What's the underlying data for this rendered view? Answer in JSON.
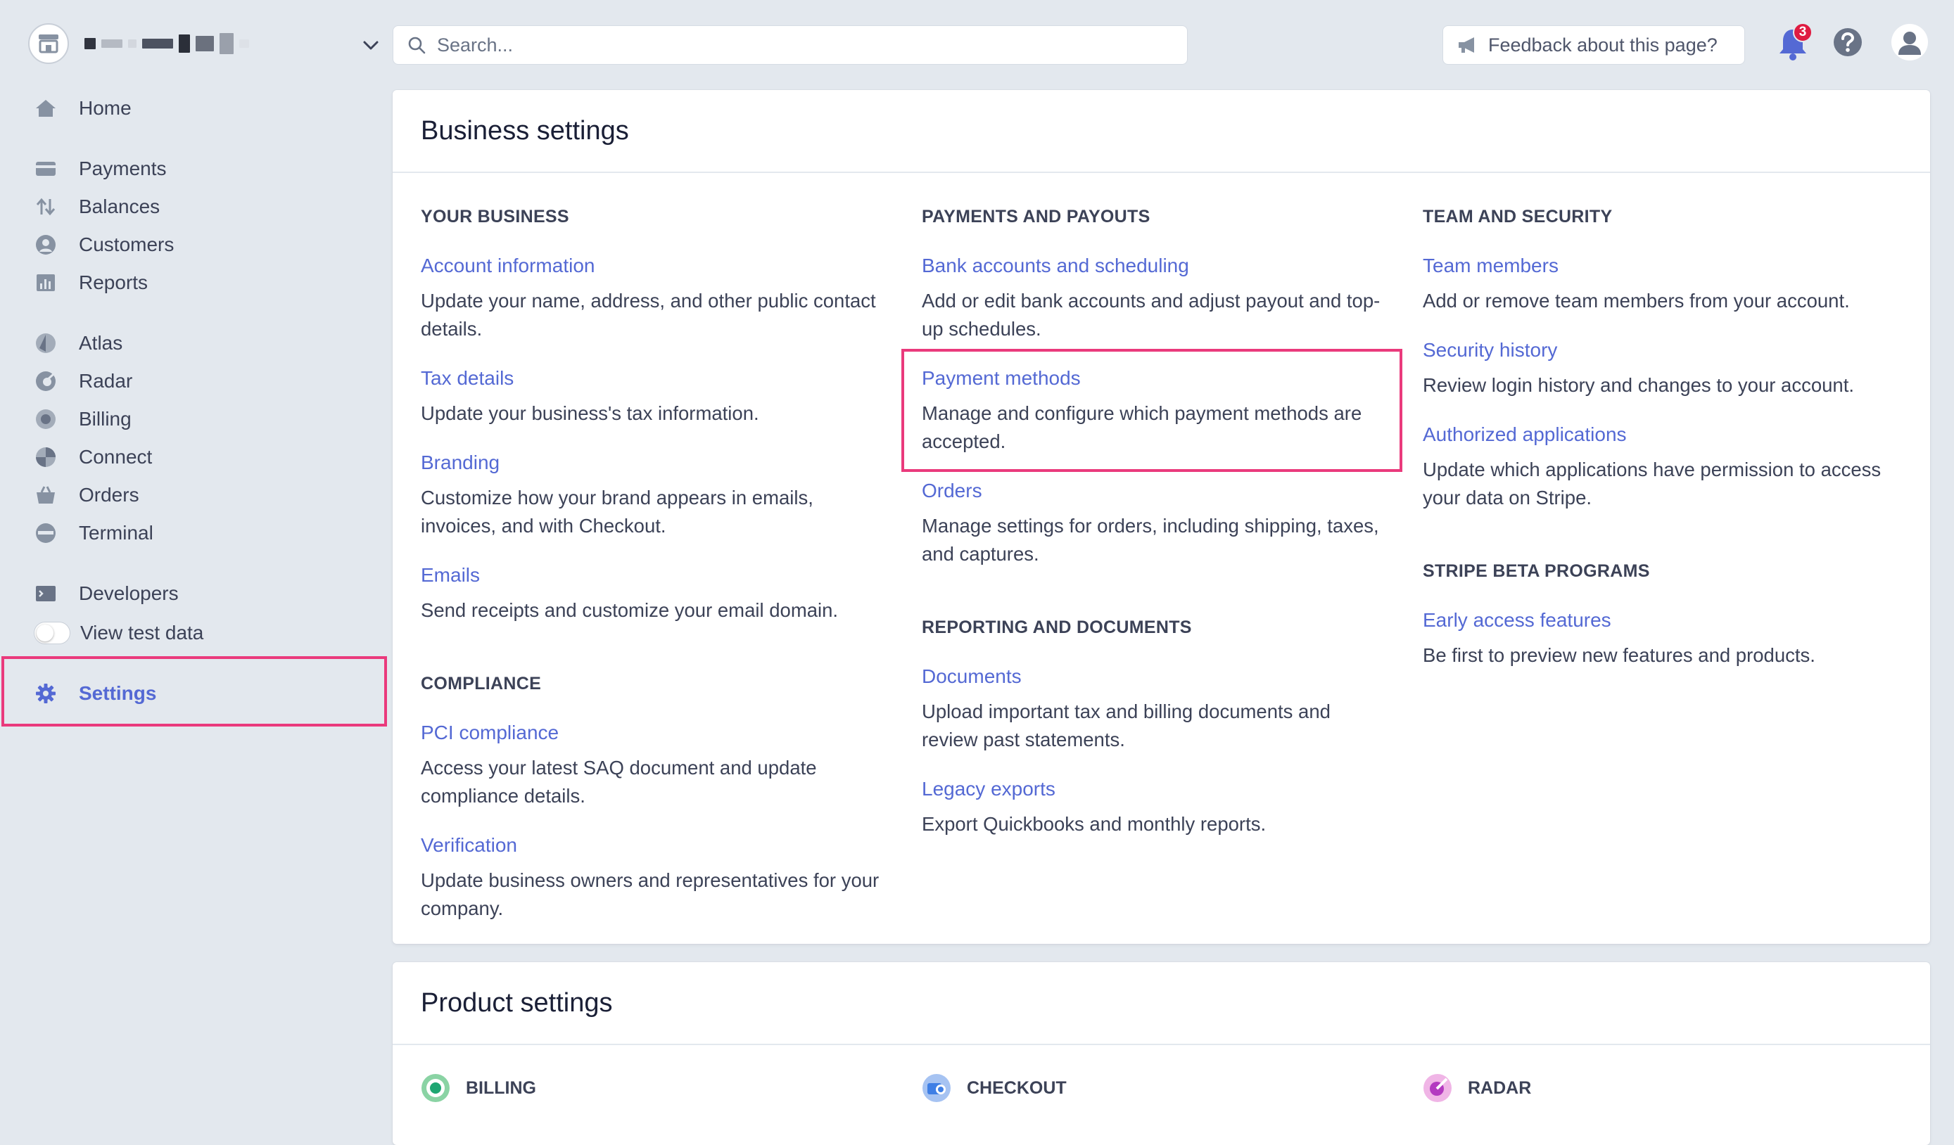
{
  "topbar": {
    "account_name": "",
    "search_placeholder": "Search...",
    "feedback_label": "Feedback about this page?",
    "notification_count": "3"
  },
  "sidebar": {
    "items": [
      {
        "label": "Home",
        "icon": "home-icon"
      },
      {
        "label": "Payments",
        "icon": "payments-icon"
      },
      {
        "label": "Balances",
        "icon": "balances-icon"
      },
      {
        "label": "Customers",
        "icon": "customers-icon"
      },
      {
        "label": "Reports",
        "icon": "reports-icon"
      },
      {
        "label": "Atlas",
        "icon": "atlas-icon"
      },
      {
        "label": "Radar",
        "icon": "radar-icon"
      },
      {
        "label": "Billing",
        "icon": "billing-icon"
      },
      {
        "label": "Connect",
        "icon": "connect-icon"
      },
      {
        "label": "Orders",
        "icon": "orders-icon"
      },
      {
        "label": "Terminal",
        "icon": "terminal-icon"
      },
      {
        "label": "Developers",
        "icon": "developers-icon"
      },
      {
        "label": "View test data",
        "icon": "toggle"
      },
      {
        "label": "Settings",
        "icon": "gear-icon",
        "active": true
      }
    ]
  },
  "business": {
    "title": "Business settings",
    "your_business": {
      "heading": "YOUR BUSINESS",
      "items": [
        {
          "title": "Account information",
          "desc": "Update your name, address, and other public contact details."
        },
        {
          "title": "Tax details",
          "desc": "Update your business's tax information."
        },
        {
          "title": "Branding",
          "desc": "Customize how your brand appears in emails, invoices, and with Checkout."
        },
        {
          "title": "Emails",
          "desc": "Send receipts and customize your email domain."
        }
      ]
    },
    "compliance": {
      "heading": "COMPLIANCE",
      "items": [
        {
          "title": "PCI compliance",
          "desc": "Access your latest SAQ document and update compliance details."
        },
        {
          "title": "Verification",
          "desc": "Update business owners and representatives for your company."
        }
      ]
    },
    "payments_payouts": {
      "heading": "PAYMENTS AND PAYOUTS",
      "items": [
        {
          "title": "Bank accounts and scheduling",
          "desc": "Add or edit bank accounts and adjust payout and top-up schedules."
        },
        {
          "title": "Payment methods",
          "desc": "Manage and configure which payment methods are accepted."
        },
        {
          "title": "Orders",
          "desc": "Manage settings for orders, including shipping, taxes, and captures."
        }
      ]
    },
    "reporting": {
      "heading": "REPORTING AND DOCUMENTS",
      "items": [
        {
          "title": "Documents",
          "desc": "Upload important tax and billing documents and review past statements."
        },
        {
          "title": "Legacy exports",
          "desc": "Export Quickbooks and monthly reports."
        }
      ]
    },
    "team_security": {
      "heading": "TEAM AND SECURITY",
      "items": [
        {
          "title": "Team members",
          "desc": "Add or remove team members from your account."
        },
        {
          "title": "Security history",
          "desc": "Review login history and changes to your account."
        },
        {
          "title": "Authorized applications",
          "desc": "Update which applications have permission to access your data on Stripe."
        }
      ]
    },
    "beta": {
      "heading": "STRIPE BETA PROGRAMS",
      "items": [
        {
          "title": "Early access features",
          "desc": "Be first to preview new features and products."
        }
      ]
    }
  },
  "product": {
    "title": "Product settings",
    "sections": [
      {
        "heading": "BILLING",
        "icon": "billing-product-icon"
      },
      {
        "heading": "CHECKOUT",
        "icon": "checkout-product-icon"
      },
      {
        "heading": "RADAR",
        "icon": "radar-product-icon"
      }
    ]
  },
  "colors": {
    "link": "#5469d4",
    "highlight": "#ea3a7c",
    "badge": "#df1b41"
  }
}
